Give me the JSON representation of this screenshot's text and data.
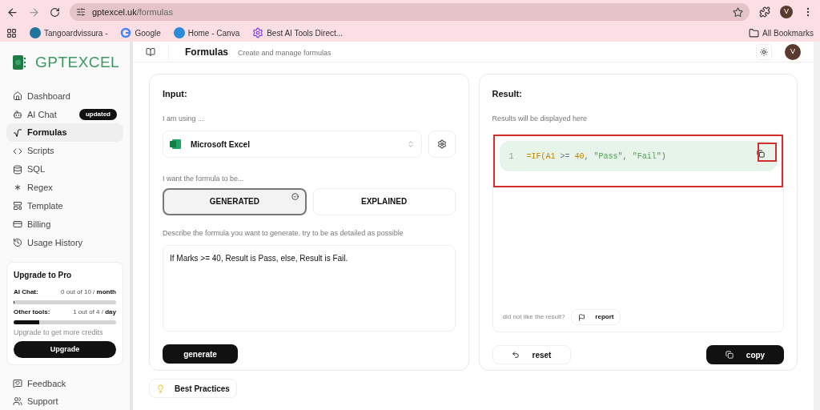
{
  "browser": {
    "url_host": "gptexcel.uk",
    "url_path": "/formulas",
    "bookmarks": [
      {
        "label": "Tangoardvissura -",
        "kind": "wordpress"
      },
      {
        "label": "Google",
        "kind": "google"
      },
      {
        "label": "Home - Canva",
        "kind": "canva"
      },
      {
        "label": "Best AI Tools Direct...",
        "kind": "gear"
      }
    ],
    "all_bookmarks": "All Bookmarks",
    "profile_initial": "V"
  },
  "sidebar": {
    "logo": "GPTEXCEL",
    "items": [
      {
        "label": "Dashboard",
        "kind": "home",
        "selected": false
      },
      {
        "label": "AI Chat",
        "kind": "bot",
        "selected": false,
        "badge": "updated"
      },
      {
        "label": "Formulas",
        "kind": "sqrt",
        "selected": true
      },
      {
        "label": "Scripts",
        "kind": "code",
        "selected": false
      },
      {
        "label": "SQL",
        "kind": "db",
        "selected": false
      },
      {
        "label": "Regex",
        "kind": "regex",
        "selected": false
      },
      {
        "label": "Template",
        "kind": "template",
        "selected": false
      },
      {
        "label": "Billing",
        "kind": "card",
        "selected": false
      },
      {
        "label": "Usage History",
        "kind": "history",
        "selected": false
      }
    ],
    "upgrade": {
      "title": "Upgrade to Pro",
      "quotas": [
        {
          "label": "AI Chat:",
          "amount": "0 out of 10 / ",
          "period": "month",
          "level": 0
        },
        {
          "label": "Other tools:",
          "amount": "1 out of 4 / ",
          "period": "day",
          "level": 0.25
        }
      ],
      "note": "Upgrade to get more credits",
      "button": "Upgrade"
    },
    "footer_items": [
      {
        "label": "Feedback",
        "kind": "feedback"
      },
      {
        "label": "Support",
        "kind": "support"
      }
    ]
  },
  "header": {
    "title": "Formulas",
    "subtitle": "Create and manage formulas",
    "avatar": "V"
  },
  "input": {
    "title": "Input:",
    "using_label": "I am using ...",
    "app": "Microsoft Excel",
    "mode_label": "I want the formula to be...",
    "modes": [
      {
        "label": "GENERATED",
        "selected": true
      },
      {
        "label": "EXPLAINED",
        "selected": false
      }
    ],
    "describe_label": "Describe the formula you want to generate. try to be as detailed as possible",
    "description": "If Marks >= 40, Result is Pass, else, Result is Fail.",
    "generate": "generate"
  },
  "best_practices": "Best Practices",
  "result": {
    "title": "Result:",
    "hint": "Results will be displayed here",
    "line_number": "1",
    "highlighted": true,
    "copy_icon_highlighted": true,
    "tokens": [
      {
        "text": "=IF(",
        "kind": "func"
      },
      {
        "text": "A1",
        "kind": "ref"
      },
      {
        "text": " >= ",
        "kind": "op"
      },
      {
        "text": "40",
        "kind": "num"
      },
      {
        "text": ", ",
        "kind": "op"
      },
      {
        "text": "\"Pass\"",
        "kind": "str"
      },
      {
        "text": ", ",
        "kind": "op"
      },
      {
        "text": "\"Fail\"",
        "kind": "str"
      },
      {
        "text": ")",
        "kind": "op"
      }
    ],
    "feedback_prompt": "did not like the result?",
    "report": "report",
    "reset": "reset",
    "copy": "copy"
  }
}
